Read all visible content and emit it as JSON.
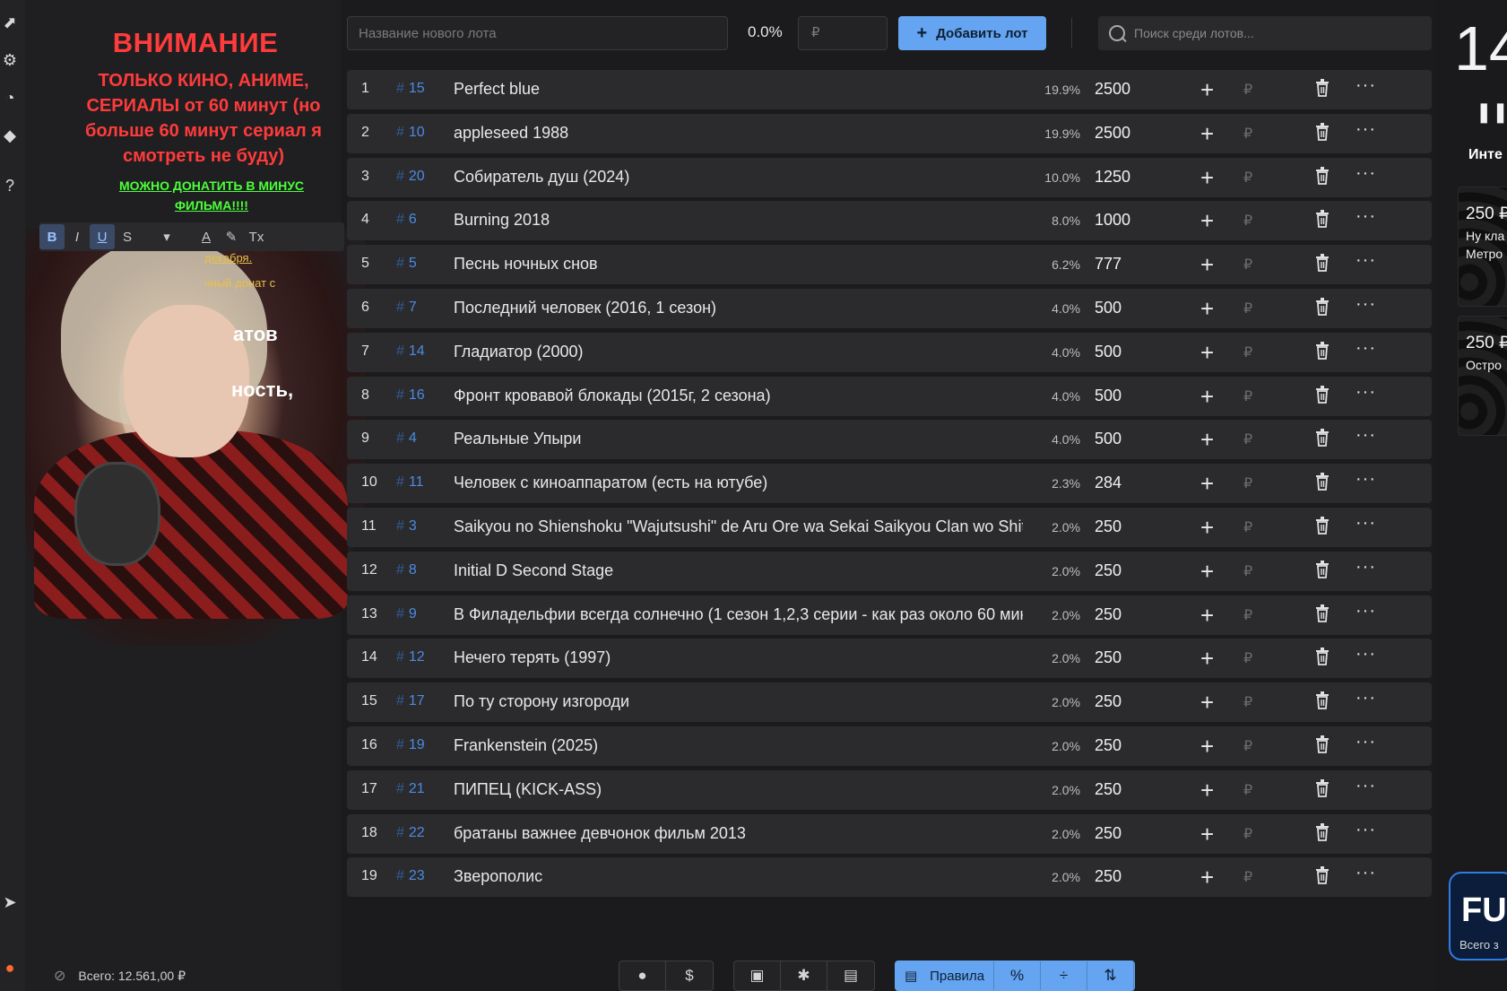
{
  "left_panel": {
    "warning_title": "ВНИМАНИЕ",
    "warning_body": "ТОЛЬКО КИНО, АНИМЕ, СЕРИАЛЫ от 60 минут (но больше 60 минут сериал я смотреть не буду)",
    "donate_note": "МОЖНО ДОНАТИТЬ В МИНУС ФИЛЬМА!!!!",
    "partial_line_1": "декабря.",
    "partial_line_2": "чный донат с",
    "partial_line_3": "атов",
    "partial_line_4": "ность,",
    "total_label": "Всего: 12.561,00 ₽"
  },
  "top_bar": {
    "new_lot_placeholder": "Название нового лота",
    "percent_value": "0.0%",
    "rub_placeholder": "₽",
    "add_button_label": "Добавить лот",
    "search_placeholder": "Поиск среди лотов..."
  },
  "lots": [
    {
      "index": "1",
      "id": "15",
      "name": "Perfect blue",
      "percent": "19.9%",
      "amount": "2500"
    },
    {
      "index": "2",
      "id": "10",
      "name": "appleseed 1988",
      "percent": "19.9%",
      "amount": "2500"
    },
    {
      "index": "3",
      "id": "20",
      "name": "Собиратель душ (2024)",
      "percent": "10.0%",
      "amount": "1250"
    },
    {
      "index": "4",
      "id": "6",
      "name": "Burning 2018",
      "percent": "8.0%",
      "amount": "1000"
    },
    {
      "index": "5",
      "id": "5",
      "name": "Песнь ночных снов",
      "percent": "6.2%",
      "amount": "777"
    },
    {
      "index": "6",
      "id": "7",
      "name": "Последний человек (2016, 1 сезон)",
      "percent": "4.0%",
      "amount": "500"
    },
    {
      "index": "7",
      "id": "14",
      "name": "Гладиатор (2000)",
      "percent": "4.0%",
      "amount": "500"
    },
    {
      "index": "8",
      "id": "16",
      "name": "Фронт кровавой блокады (2015г, 2 сезона)",
      "percent": "4.0%",
      "amount": "500"
    },
    {
      "index": "9",
      "id": "4",
      "name": "Реальные Упыри",
      "percent": "4.0%",
      "amount": "500"
    },
    {
      "index": "10",
      "id": "11",
      "name": "Человек с киноаппаратом (есть на ютубе)",
      "percent": "2.3%",
      "amount": "284"
    },
    {
      "index": "11",
      "id": "3",
      "name": "Saikyou no Shienshoku \"Wajutsushi\" de Aru Ore wa Sekai Saikyou Clan wo Shit:",
      "percent": "2.0%",
      "amount": "250"
    },
    {
      "index": "12",
      "id": "8",
      "name": "Initial D Second Stage",
      "percent": "2.0%",
      "amount": "250"
    },
    {
      "index": "13",
      "id": "9",
      "name": "В Филадельфии всегда солнечно (1 сезон 1,2,3 серии - как раз около 60 мин",
      "percent": "2.0%",
      "amount": "250"
    },
    {
      "index": "14",
      "id": "12",
      "name": "Нечего терять (1997)",
      "percent": "2.0%",
      "amount": "250"
    },
    {
      "index": "15",
      "id": "17",
      "name": "По ту сторону изгороди",
      "percent": "2.0%",
      "amount": "250"
    },
    {
      "index": "16",
      "id": "19",
      "name": "Frankenstein (2025)",
      "percent": "2.0%",
      "amount": "250"
    },
    {
      "index": "17",
      "id": "21",
      "name": "ПИПЕЦ (KICK-ASS)",
      "percent": "2.0%",
      "amount": "250"
    },
    {
      "index": "18",
      "id": "22",
      "name": "братаны важнее девчонок фильм 2013",
      "percent": "2.0%",
      "amount": "250"
    },
    {
      "index": "19",
      "id": "23",
      "name": "Зверополис",
      "percent": "2.0%",
      "amount": "250"
    }
  ],
  "row_icons": {
    "plus": "plus-icon",
    "rub": "ruble-icon",
    "trash": "trash-icon",
    "more": "more-icon"
  },
  "bottom_toolbar": {
    "rules_label": "Правила",
    "percent_symbol": "%"
  },
  "right_panel": {
    "timer_partial": "14",
    "header_partial": "Инте",
    "card1_amount": "250 ₽",
    "card1_who": "Ну кла",
    "card1_msg": "Метро",
    "card2_amount": "250 ₽",
    "card2_who": "Остро",
    "badge_text": "FU",
    "badge_sub": "Всего з"
  },
  "colors": {
    "accent": "#64a4f0",
    "warning_red": "#ff3b3b",
    "donate_green": "#4cff3a",
    "id_blue": "#4b8be0",
    "row_bg": "#2b2b2e",
    "page_bg": "#1b1b1d"
  }
}
